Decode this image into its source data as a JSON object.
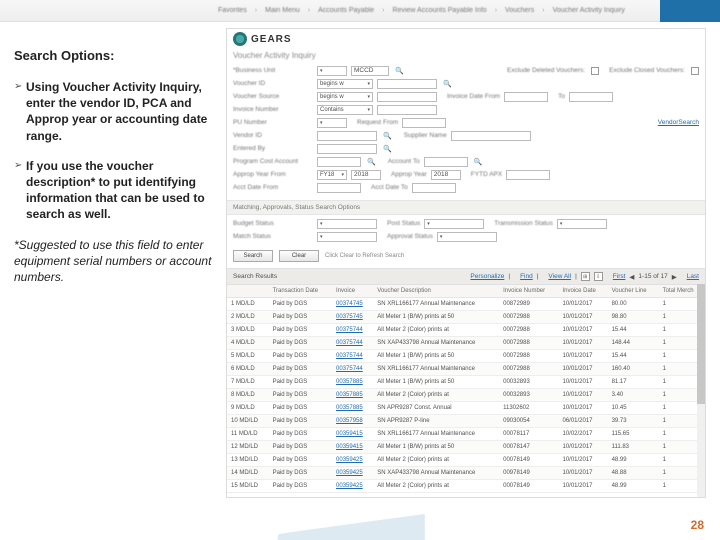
{
  "ribbon": {
    "crumbs": [
      "Favorites",
      "Main Menu",
      "Accounts Payable",
      "Review Accounts Payable Info",
      "Vouchers",
      "Voucher Activity Inquiry"
    ]
  },
  "left": {
    "heading": "Search Options:",
    "bullet1": "Using Voucher Activity Inquiry, enter the vendor ID, PCA and Approp year or accounting date range.",
    "bullet2": "If you use the voucher description* to put identifying information that can be used to search as well.",
    "footnote": "*Suggested to use this field to enter equipment serial numbers or account numbers."
  },
  "app": {
    "brand_name": "GEARS",
    "brand_sub": "",
    "page_title": "Voucher Activity Inquiry",
    "form": {
      "business_unit": {
        "label": "*Business Unit",
        "value": "MCCD"
      },
      "voucher_id": {
        "label": "Voucher ID"
      },
      "voucher_source": {
        "label": "Voucher Source"
      },
      "invoice_number": {
        "label": "Invoice Number",
        "value": "Contains"
      },
      "vendor_id": {
        "label": "Vendor ID"
      },
      "entered_by": {
        "label": "Entered By"
      },
      "pu_number": {
        "label": "PU Number"
      },
      "program_cost_account": {
        "label": "Program Cost Account"
      },
      "approp_year_from": {
        "label": "Approp Year From",
        "value": "2018"
      },
      "approp_year_to": {
        "label": "Approp Year",
        "value": "2018"
      },
      "acct_date_from": {
        "label": "Acct Date From"
      },
      "acct_date_to": {
        "label": "Acct Date To"
      },
      "exclude_deleted": {
        "label": "Exclude Deleted Vouchers:"
      },
      "exclude_closed": {
        "label": "Exclude Closed Vouchers:"
      },
      "invoice_date_from": {
        "label": "Invoice Date From"
      },
      "invoice_date_to": {
        "label": "To"
      },
      "supplier_name": {
        "label": "Supplier Name"
      },
      "request_from": {
        "label": "Request From"
      },
      "fytd_apx": {
        "label": "FYTD APX"
      },
      "account_to": {
        "label": "Account To"
      },
      "vendor_search_link": "VendorSearch"
    },
    "section_matching": "Matching, Approvals, Status Search Options",
    "status_row": {
      "budget_status": {
        "label": "Budget Status"
      },
      "post_status": {
        "label": "Post Status"
      },
      "match_status": {
        "label": "Match Status"
      },
      "approval_status": {
        "label": "Approval Status"
      },
      "transmission_status": {
        "label": "Transmission Status"
      }
    },
    "buttons": {
      "search": "Search",
      "clear": "Clear",
      "hint": "Click Clear to Refresh Search"
    },
    "results": {
      "title": "Search Results",
      "personalize": "Personalize",
      "find": "Find",
      "view_all": "View All",
      "count": "1-15 of 17",
      "first": "First",
      "last": "Last",
      "cols": [
        "",
        "Transaction Date",
        "Invoice",
        "Voucher Description",
        "Invoice Number",
        "Invoice Date",
        "Voucher Line",
        "Total Merch"
      ],
      "rows": [
        [
          "1 MD/LD",
          "Paid by DGS",
          "00374745",
          "SN XRL166177 Annual Maintenance",
          "00872989",
          "10/01/2017",
          "80.00",
          "1"
        ],
        [
          "2 MD/LD",
          "Paid by DGS",
          "00375745",
          "All Meter 1 (B/W) prints at 50",
          "00072988",
          "10/01/2017",
          "98.80",
          "1"
        ],
        [
          "3 MD/LD",
          "Paid by DGS",
          "00375744",
          "All Meter 2 (Color) prints at",
          "00072988",
          "10/01/2017",
          "15.44",
          "1"
        ],
        [
          "4 MD/LD",
          "Paid by DGS",
          "00375744",
          "SN XAP433798 Annual Maintenance",
          "00072988",
          "10/01/2017",
          "148.44",
          "1"
        ],
        [
          "5 MD/LD",
          "Paid by DGS",
          "00375744",
          "All Meter 1 (B/W) prints at 50",
          "00072988",
          "10/01/2017",
          "15.44",
          "1"
        ],
        [
          "6 MD/LD",
          "Paid by DGS",
          "00375744",
          "SN XRL166177 Annual Maintenance",
          "00072988",
          "10/01/2017",
          "160.40",
          "1"
        ],
        [
          "7 MD/LD",
          "Paid by DGS",
          "00357885",
          "All Meter 1 (B/W) prints at 50",
          "00032893",
          "10/01/2017",
          "81.17",
          "1"
        ],
        [
          "8 MD/LD",
          "Paid by DGS",
          "00357885",
          "All Meter 2 (Color) prints at",
          "00032893",
          "10/01/2017",
          "3.40",
          "1"
        ],
        [
          "9 MD/LD",
          "Paid by DGS",
          "00357885",
          "SN APR9287 Const. Annual",
          "11302602",
          "10/01/2017",
          "10.45",
          "1"
        ],
        [
          "10 MD/LD",
          "Paid by DGS",
          "00357958",
          "SN APR9287 P-line",
          "09030054",
          "06/01/2017",
          "39.73",
          "1"
        ],
        [
          "11 MD/LD",
          "Paid by DGS",
          "00359415",
          "SN XRL166177 Annual Maintenance",
          "00078117",
          "10/02/2017",
          "115.65",
          "1"
        ],
        [
          "12 MD/LD",
          "Paid by DGS",
          "00359415",
          "All Meter 1 (B/W) prints at 50",
          "00078147",
          "10/01/2017",
          "111.83",
          "1"
        ],
        [
          "13 MD/LD",
          "Paid by DGS",
          "00359425",
          "All Meter 2 (Color) prints at",
          "00078149",
          "10/01/2017",
          "48.99",
          "1"
        ],
        [
          "14 MD/LD",
          "Paid by DGS",
          "00359425",
          "SN XAP433798 Annual Maintenance",
          "00978149",
          "10/01/2017",
          "48.88",
          "1"
        ],
        [
          "15 MD/LD",
          "Paid by DGS",
          "00359425",
          "All Meter 2 (Color) prints at",
          "00078149",
          "10/01/2017",
          "48.99",
          "1"
        ]
      ]
    }
  },
  "page_number": "28"
}
